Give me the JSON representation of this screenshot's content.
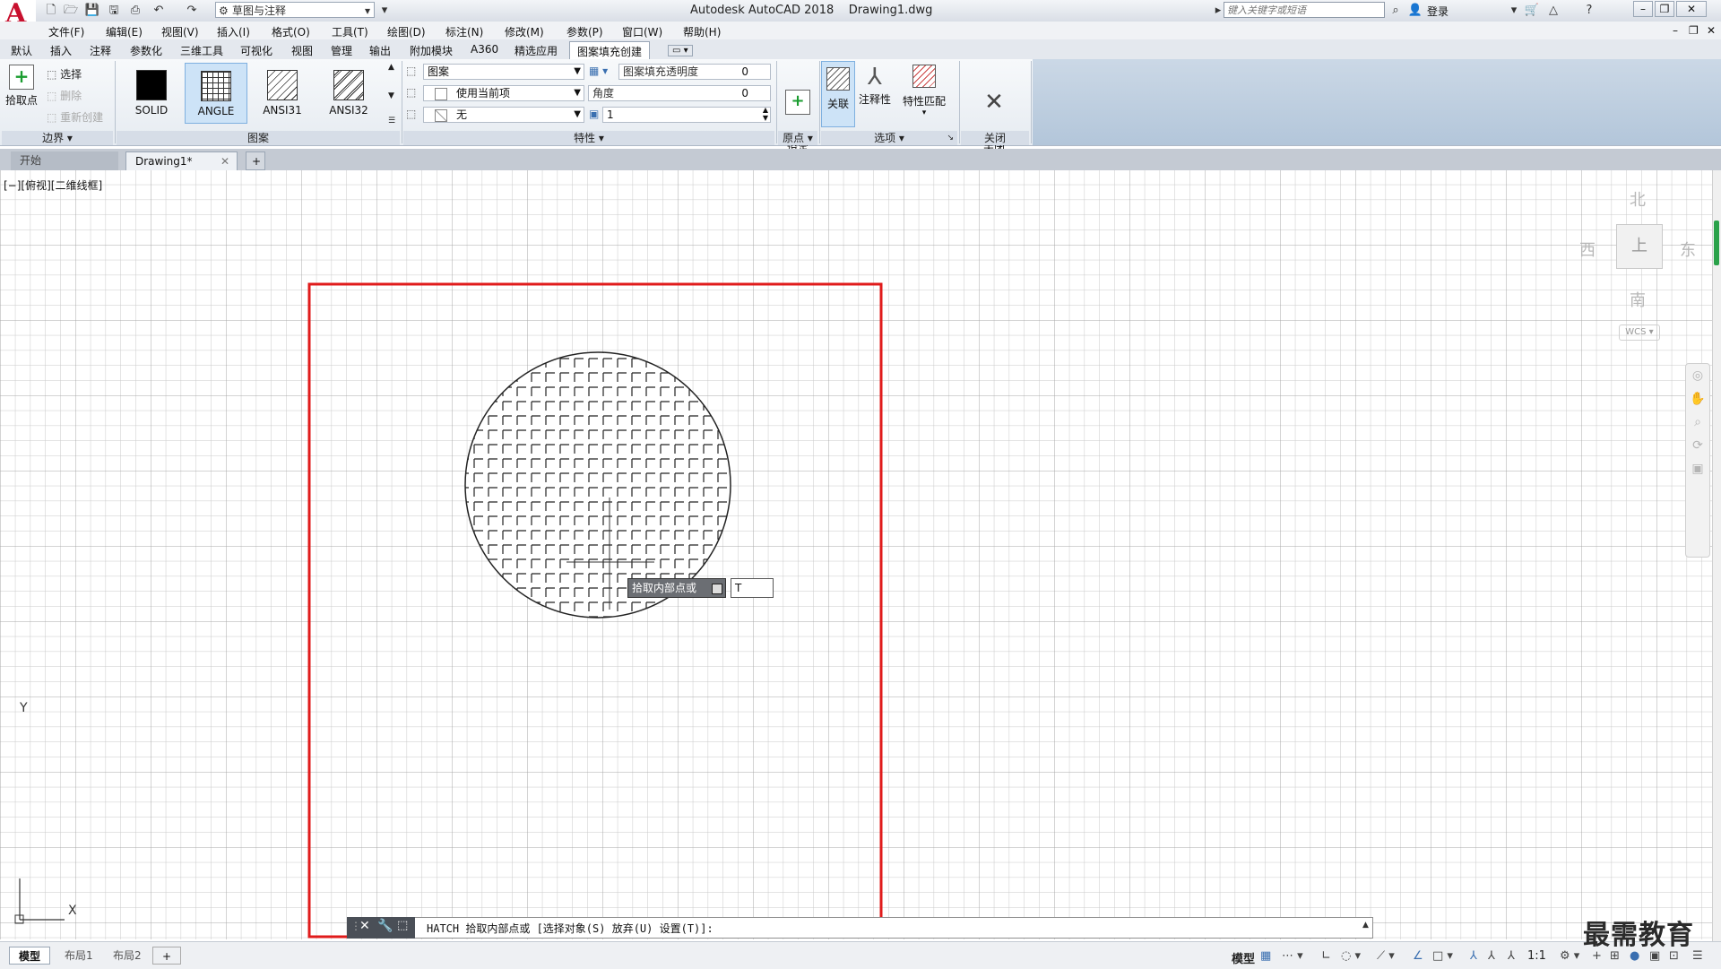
{
  "app": {
    "title": "Autodesk AutoCAD 2018    Drawing1.dwg",
    "logo": "A",
    "workspace": "草图与注释",
    "search_placeholder": "键入关键字或短语",
    "login": "登录"
  },
  "menu": [
    "文件(F)",
    "编辑(E)",
    "视图(V)",
    "插入(I)",
    "格式(O)",
    "工具(T)",
    "绘图(D)",
    "标注(N)",
    "修改(M)",
    "参数(P)",
    "窗口(W)",
    "帮助(H)"
  ],
  "ribbon_tabs": [
    "默认",
    "插入",
    "注释",
    "参数化",
    "三维工具",
    "可视化",
    "视图",
    "管理",
    "输出",
    "附加模块",
    "A360",
    "精选应用"
  ],
  "ribbon_active_tab": "图案填充创建",
  "ribbon": {
    "boundary": {
      "pick_point": "拾取点",
      "select": "选择",
      "remove": "删除",
      "recreate": "重新创建",
      "panel": "边界"
    },
    "pattern": {
      "tiles": [
        "SOLID",
        "ANGLE",
        "ANSI31",
        "ANSI32"
      ],
      "selected": "ANGLE",
      "panel": "图案"
    },
    "properties": {
      "type": "图案",
      "color": "使用当前项",
      "background": "无",
      "transparency_label": "图案填充透明度",
      "transparency_value": "0",
      "angle_label": "角度",
      "angle_value": "0",
      "scale_value": "1",
      "panel": "特性"
    },
    "origin": {
      "set_origin": "设定\n原点",
      "panel": "原点"
    },
    "options": {
      "associative": "关联",
      "annotative": "注释性",
      "match": "特性匹配",
      "panel": "选项"
    },
    "close": {
      "label": "关闭\n图案填充创建",
      "panel": "关闭"
    }
  },
  "doc_tabs": {
    "start": "开始",
    "drawing": "Drawing1*"
  },
  "viewport_label": "[−][俯视][二维线框]",
  "viewcube": {
    "north": "北",
    "south": "南",
    "east": "东",
    "west": "西",
    "top": "上",
    "wcs": "WCS"
  },
  "prompt": {
    "tooltip": "拾取内部点或",
    "input": "T"
  },
  "command_line": "HATCH 拾取内部点或 [选择对象(S) 放弃(U) 设置(T)]:",
  "layout_tabs": [
    "模型",
    "布局1",
    "布局2"
  ],
  "status": {
    "model": "模型",
    "scale": "1:1"
  },
  "ucs": {
    "x": "X",
    "y": "Y"
  },
  "watermark": "最需教育"
}
